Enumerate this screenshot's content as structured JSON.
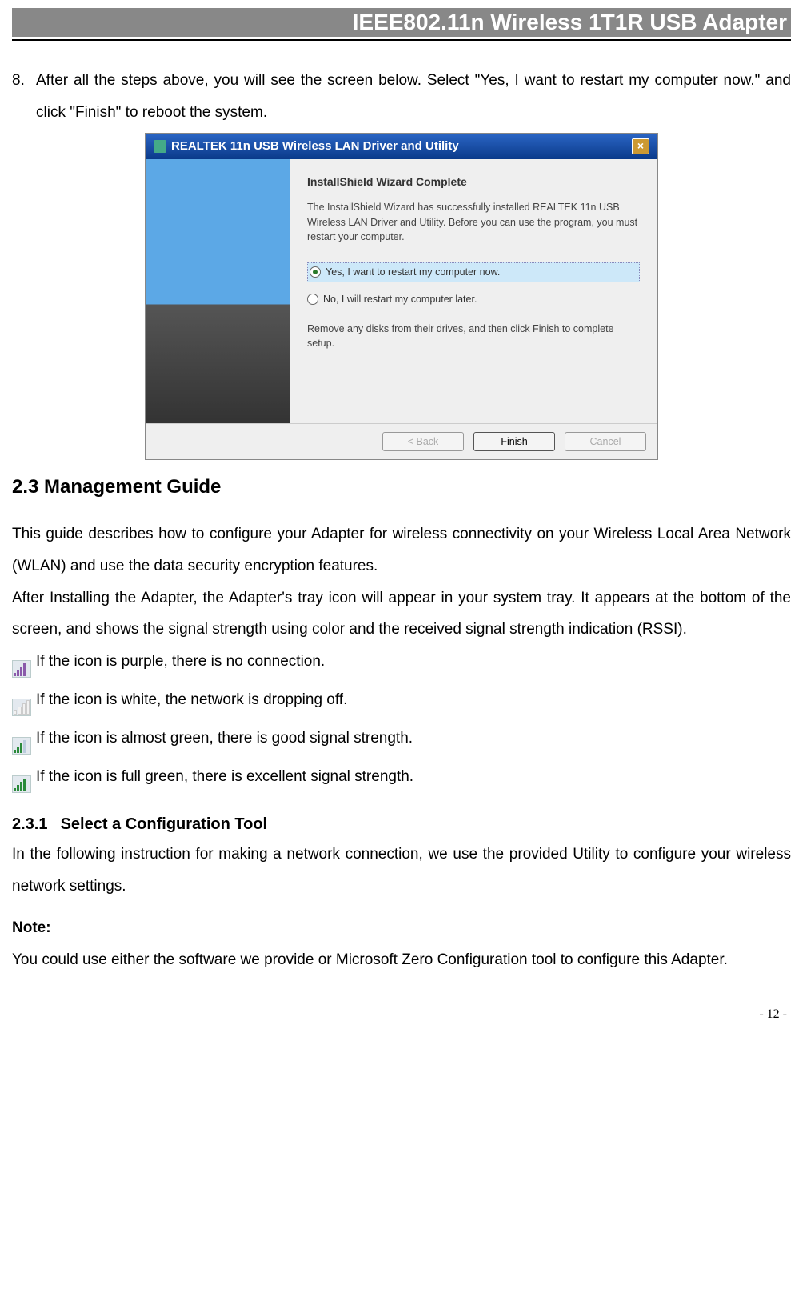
{
  "header": {
    "title": "IEEE802.11n Wireless 1T1R USB Adapter"
  },
  "step": {
    "num": "8.",
    "text": "After all the steps above, you will see the screen below. Select \"Yes, I want to restart my computer now.\" and click \"Finish\" to reboot the system."
  },
  "installer": {
    "title": "REALTEK 11n USB Wireless LAN Driver and Utility",
    "heading": "InstallShield Wizard Complete",
    "para": "The InstallShield Wizard has successfully installed REALTEK 11n USB Wireless LAN Driver and Utility. Before you can use the program, you must restart your computer.",
    "radio_yes": "Yes, I want to restart my computer now.",
    "radio_no": "No, I will restart my computer later.",
    "remove_text": "Remove any disks from their drives, and then click Finish to complete setup.",
    "btn_back": "< Back",
    "btn_finish": "Finish",
    "btn_cancel": "Cancel"
  },
  "section23": {
    "heading": "2.3 Management Guide",
    "p1": "This guide describes how to configure your Adapter for wireless connectivity on your Wireless Local Area Network (WLAN) and use the data security encryption features.",
    "p2": "After Installing the Adapter, the Adapter's tray icon will appear in your system tray. It appears at the bottom of the screen, and shows the signal strength using color and the received signal strength indication (RSSI).",
    "icon_purple": "If the icon is purple, there is no connection.",
    "icon_white": "If the icon is white, the network is dropping off.",
    "icon_green1": "If the icon is almost green, there is good signal strength.",
    "icon_green2": "If the icon is full green, there is excellent signal strength."
  },
  "section231": {
    "num": "2.3.1",
    "heading": "Select a Configuration Tool",
    "p1": "In the following instruction for making a network connection, we use the provided Utility to configure your wireless network settings.",
    "note_label": "Note:",
    "note_text": "You could use either the software we provide or Microsoft Zero Configuration tool to configure this Adapter."
  },
  "page_num": "- 12 -"
}
